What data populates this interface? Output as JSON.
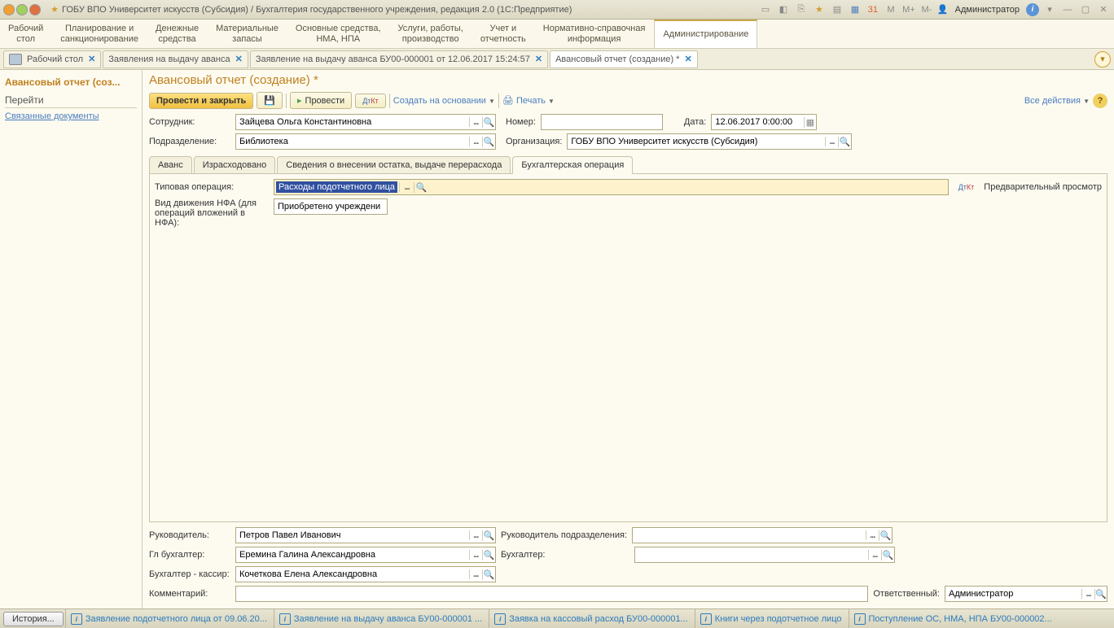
{
  "titlebar": {
    "title": "ГОБУ ВПО Университет искусств (Субсидия) / Бухгалтерия государственного учреждения, редакция 2.0  (1С:Предприятие)",
    "admin": "Администратор",
    "icons": {
      "m": "M",
      "mplus": "M+",
      "mminus": "M-"
    }
  },
  "mainnav": {
    "items": [
      "Рабочий\nстол",
      "Планирование и\nсанкционирование",
      "Денежные\nсредства",
      "Материальные\nзапасы",
      "Основные средства,\nНМА, НПА",
      "Услуги, работы,\nпроизводство",
      "Учет и\nотчетность",
      "Нормативно-справочная\nинформация",
      "Администрирование"
    ]
  },
  "tabs": [
    {
      "label": "Рабочий стол"
    },
    {
      "label": "Заявления на выдачу аванса"
    },
    {
      "label": "Заявление на выдачу аванса БУ00-000001 от 12.06.2017 15:24:57"
    },
    {
      "label": "Авансовый отчет (создание) *"
    }
  ],
  "sidebar": {
    "title": "Авансовый отчет (соз...",
    "section": "Перейти",
    "link": "Связанные документы"
  },
  "content": {
    "title": "Авансовый отчет (создание) *",
    "toolbar": {
      "primary": "Провести и закрыть",
      "post": "Провести",
      "createOn": "Создать на основании",
      "print": "Печать",
      "allActions": "Все действия"
    },
    "fields": {
      "employee_label": "Сотрудник:",
      "employee": "Зайцева Ольга Константиновна",
      "number_label": "Номер:",
      "number": "",
      "date_label": "Дата:",
      "date": "12.06.2017 0:00:00",
      "dept_label": "Подразделение:",
      "dept": "Библиотека",
      "org_label": "Организация:",
      "org": "ГОБУ ВПО Университет искусств (Субсидия)"
    },
    "innertabs": [
      "Аванс",
      "Израсходовано",
      "Сведения о внесении остатка, выдаче перерасхода",
      "Бухгалтерская операция"
    ],
    "operation": {
      "typical_label": "Типовая операция:",
      "typical": "Расходы подотчетного лица",
      "preview": "Предварительный просмотр",
      "nfa_label": "Вид движения НФА (для операций вложений в НФА):",
      "nfa": "Приобретено учреждени"
    },
    "bottom": {
      "manager_label": "Руководитель:",
      "manager": "Петров Павел Иванович",
      "dept_manager_label": "Руководитель подразделения:",
      "dept_manager": "",
      "chief_acc_label": "Гл бухгалтер:",
      "chief_acc": "Еремина Галина Александровна",
      "acc_label": "Бухгалтер:",
      "acc": "",
      "cashier_label": "Бухгалтер - кассир:",
      "cashier": "Кочеткова Елена Александровна",
      "comment_label": "Комментарий:",
      "comment": "",
      "responsible_label": "Ответственный:",
      "responsible": "Администратор"
    }
  },
  "statusbar": {
    "history": "История...",
    "items": [
      "Заявление подотчетного лица от 09.06.20...",
      "Заявление на выдачу аванса БУ00-000001 ...",
      "Заявка на кассовый расход БУ00-000001...",
      "Книги через подотчетное лицо",
      "Поступление ОС, НМА, НПА БУ00-000002..."
    ]
  }
}
